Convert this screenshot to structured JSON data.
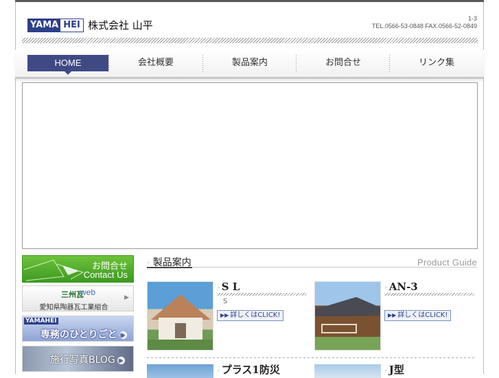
{
  "header": {
    "logo_a": "YAMA",
    "logo_b": "HEI",
    "company_name": "株式会社 山平",
    "address_line1": "1-3",
    "address_line2": "TEL.0566-53-0848 FAX.0566-52-0849"
  },
  "nav": {
    "items": [
      "HOME",
      "会社概要",
      "製品案内",
      "お問合せ",
      "リンク集"
    ],
    "active": "HOME"
  },
  "sidebar": {
    "contact": {
      "label_jp": "お問合せ",
      "label_en": "Contact Us"
    },
    "sanshu": {
      "mark": "三州瓦",
      "web": "web",
      "caption": "愛知県陶器瓦工業組合"
    },
    "blog1": {
      "logo": "YAMAHEI",
      "label": "専務のひとりごと"
    },
    "blog2": {
      "label": "施行写真BLOG"
    }
  },
  "products": {
    "section_title": "製品案内",
    "section_title_en": "Product Guide",
    "items": [
      {
        "name": "S L",
        "desc": "S",
        "button": "詳しくはCLICK!"
      },
      {
        "name": "AN-3",
        "desc": "",
        "button": "詳しくはCLICK!"
      },
      {
        "name": "プラス1防災",
        "desc": "",
        "button": ""
      },
      {
        "name": "J型",
        "desc": "",
        "button": ""
      }
    ]
  },
  "colors": {
    "nav_active": "#3f4a85",
    "contact_green": "#4fae2c",
    "brand_blue": "#2d3f8a"
  }
}
